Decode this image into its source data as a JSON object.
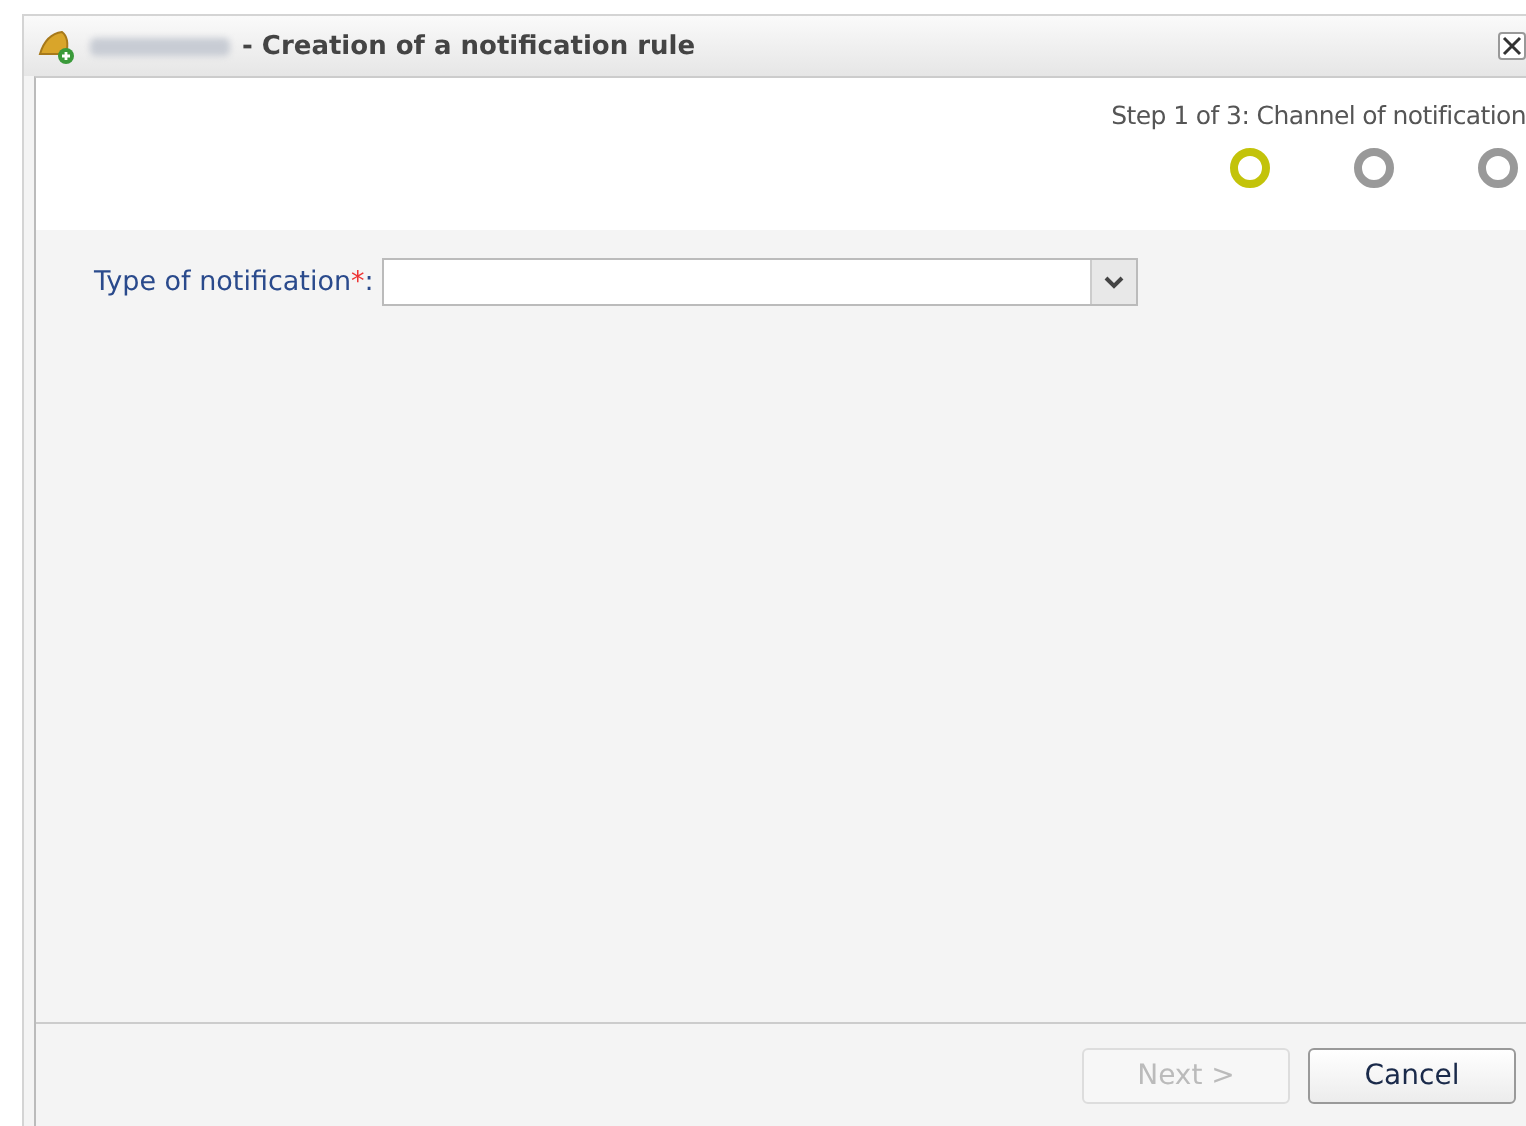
{
  "window": {
    "title": "- Creation of a notification rule"
  },
  "wizard": {
    "step_label": "Step 1 of 3: Channel of notification",
    "steps": [
      {
        "selected": true
      },
      {
        "selected": false
      },
      {
        "selected": false
      }
    ]
  },
  "form": {
    "fields": [
      {
        "label": "Type of notification",
        "required_mark": "*",
        "separator": ":",
        "kind": "select"
      }
    ]
  },
  "buttons": [
    {
      "label": "Next >",
      "disabled": true
    },
    {
      "label": "Cancel",
      "disabled": false
    }
  ]
}
